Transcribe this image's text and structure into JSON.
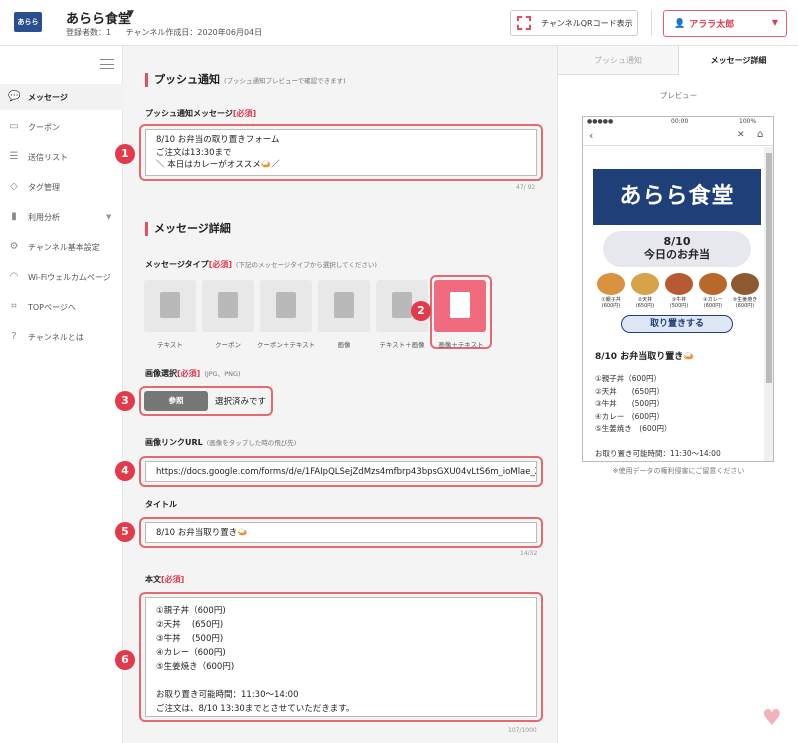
{
  "header": {
    "logo_text": "あらら",
    "shop_name": "あらら食堂",
    "subscribers": "登録者数：1",
    "created": "チャンネル作成日：2020年06月04日",
    "qr_button": "チャンネルQRコード表示",
    "user_name": "アララ太郎"
  },
  "sidebar": {
    "items": [
      {
        "label": "メッセージ",
        "icon": "chat-icon"
      },
      {
        "label": "クーポン",
        "icon": "coupon-icon"
      },
      {
        "label": "送信リスト",
        "icon": "list-icon"
      },
      {
        "label": "タグ管理",
        "icon": "tag-icon"
      },
      {
        "label": "利用分析",
        "icon": "chart-icon"
      },
      {
        "label": "チャンネル基本設定",
        "icon": "gear-icon"
      },
      {
        "label": "Wi-Fiウェルカムページ",
        "icon": "wifi-icon"
      },
      {
        "label": "TOPページへ",
        "icon": "qr-icon"
      },
      {
        "label": "チャンネルとは",
        "icon": "help-icon"
      }
    ]
  },
  "push": {
    "title": "プッシュ通知",
    "title_note": "(プッシュ通知プレビューで確認できます)",
    "msg_label": "プッシュ通知メッセージ",
    "required": "[必須]",
    "msg_value": "8/10 お弁当の取り置きフォーム\nご注文は13:30まで\n＼ 本日はカレーがオススメ🍛／",
    "msg_counter": "47/ 92"
  },
  "detail": {
    "title": "メッセージ詳細",
    "type_label": "メッセージタイプ",
    "type_note": "(下記のメッセージタイプから選択してください)",
    "types": [
      "テキスト",
      "クーポン",
      "クーポン＋テキスト",
      "画像",
      "テキスト＋画像",
      "画像＋テキスト"
    ],
    "image_label": "画像選択",
    "image_note": "(JPG、PNG)",
    "browse": "参照",
    "browse_status": "選択済みです",
    "link_label": "画像リンクURL",
    "link_note": "(画像をタップした時の飛び先)",
    "link_value": "https://docs.google.com/forms/d/e/1FAIpQLSejZdMzs4mfbrp43bpsGXU04vLtS6m_ioMlae_ZVa",
    "title_label": "タイトル",
    "title_value": "8/10 お弁当取り置き🍛",
    "title_counter": "14/32",
    "body_label": "本文",
    "body_value": "①親子丼（600円)\n②天丼　 (650円)\n③牛丼　 (500円)\n④カレー（600円)\n⑤生姜焼き（600円)\n\nお取り置き可能時間：11:30～14:00\nご注文は、8/10 13:30までとさせていただきます。",
    "body_counter": "107/1000"
  },
  "badges": [
    "1",
    "2",
    "3",
    "4",
    "5",
    "6"
  ],
  "preview": {
    "tab_push": "プッシュ通知",
    "tab_detail": "メッセージ詳細",
    "label": "プレビュー",
    "status_time": "00:00",
    "status_battery": "100%",
    "banner_text": "あらら食堂",
    "today_date": "8/10",
    "today_text": "今日のお弁当",
    "foods": [
      "①親子丼\n(600円)",
      "②天丼\n(650円)",
      "③牛丼\n(500円)",
      "④カレー\n(600円)",
      "⑤生姜焼き\n(600円)"
    ],
    "pickup_text": "取り置きする",
    "title": "8/10 お弁当取り置き🍛",
    "body": "①親子丼（600円）\n②天丼　　(650円）\n③牛丼　　(500円）\n④カレー　(600円）\n⑤生姜焼き　(600円）\n\nお取り置き可能時間：11:30～14:00",
    "copyright": "※使用データの権利侵害にご留意ください"
  },
  "colors": {
    "accent": "#e03c50",
    "highlight_ring": "#e46a72",
    "brand_navy": "#1f3f78"
  }
}
